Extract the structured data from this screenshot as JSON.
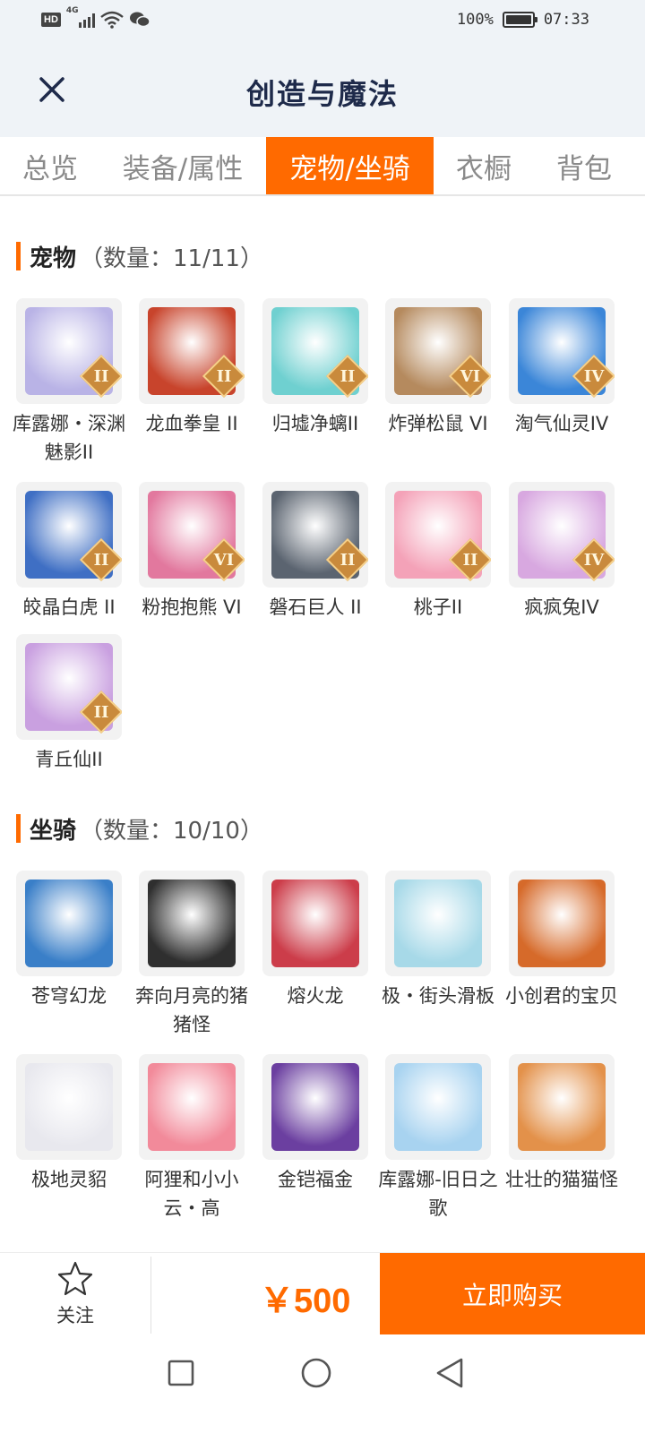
{
  "status_bar": {
    "network": "HD",
    "signal": "4G",
    "battery": "100%",
    "time": "07:33"
  },
  "header": {
    "title": "创造与魔法",
    "close_icon": "close-icon"
  },
  "tabs": [
    {
      "label": "总览",
      "active": false
    },
    {
      "label": "装备/属性",
      "active": false
    },
    {
      "label": "宠物/坐骑",
      "active": true
    },
    {
      "label": "衣橱",
      "active": false
    },
    {
      "label": "背包",
      "active": false
    }
  ],
  "pets": {
    "title": "宠物",
    "count": "（数量：11/11）",
    "items": [
      {
        "name": "库露娜・深渊魅影II",
        "grade": "II",
        "color": "#b9b3e6"
      },
      {
        "name": "龙血拳皇 II",
        "grade": "II",
        "color": "#c8442c"
      },
      {
        "name": "归墟净螭II",
        "grade": "II",
        "color": "#6fd0d0"
      },
      {
        "name": "炸弹松鼠 VI",
        "grade": "VI",
        "color": "#b58a5e"
      },
      {
        "name": "淘气仙灵IV",
        "grade": "IV",
        "color": "#3b86d8"
      },
      {
        "name": "皎晶白虎 II",
        "grade": "II",
        "color": "#3f6fc4"
      },
      {
        "name": "粉抱抱熊 VI",
        "grade": "VI",
        "color": "#e2789e"
      },
      {
        "name": "磐石巨人 II",
        "grade": "II",
        "color": "#5b6470"
      },
      {
        "name": "桃子II",
        "grade": "II",
        "color": "#f4a2b8"
      },
      {
        "name": "疯疯兔IV",
        "grade": "IV",
        "color": "#d8a8e0"
      },
      {
        "name": "青丘仙II",
        "grade": "II",
        "color": "#c9a0e0"
      }
    ]
  },
  "mounts": {
    "title": "坐骑",
    "count": "（数量：10/10）",
    "items": [
      {
        "name": "苍穹幻龙",
        "color": "#3a7fc8"
      },
      {
        "name": "奔向月亮的猪猪怪",
        "color": "#2f2f2f"
      },
      {
        "name": "熔火龙",
        "color": "#cc3d4a"
      },
      {
        "name": "极・街头滑板",
        "color": "#a7d9e8"
      },
      {
        "name": "小创君的宝贝",
        "color": "#d66a2a"
      },
      {
        "name": "极地灵貂",
        "color": "#e8e8ee"
      },
      {
        "name": "阿狸和小小云・高",
        "color": "#f28a9a"
      },
      {
        "name": "金铠福金",
        "color": "#6b3fa0"
      },
      {
        "name": "库露娜-旧日之歌",
        "color": "#a8d3f0"
      },
      {
        "name": "壮壮的猫猫怪",
        "color": "#e3914a"
      }
    ]
  },
  "footer": {
    "follow_label": "关注",
    "price": "￥500",
    "buy_label": "立即购买"
  },
  "colors": {
    "accent": "#ff6a00",
    "title": "#1e2a4a"
  }
}
